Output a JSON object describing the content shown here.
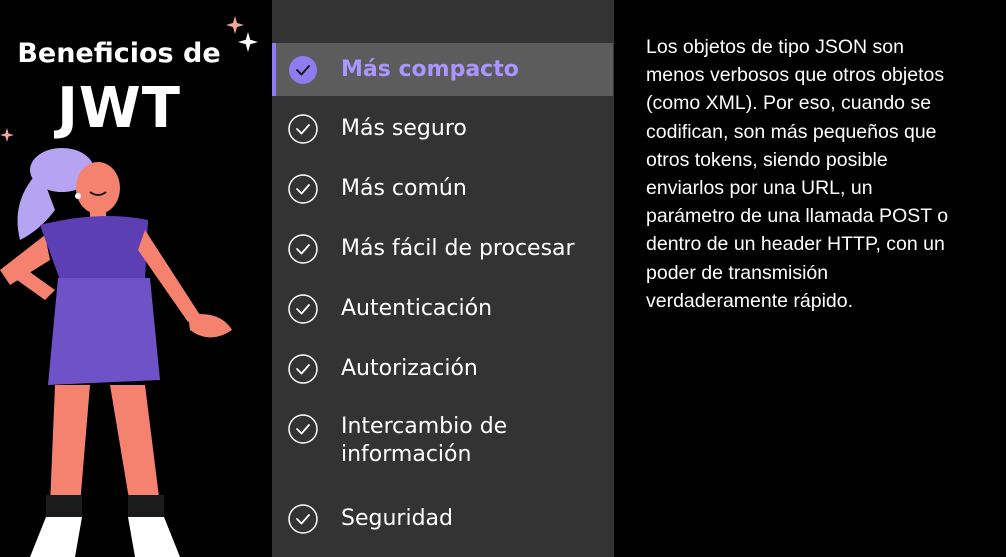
{
  "sidebar": {
    "title_line1": "Beneficios de",
    "title_line2": "JWT"
  },
  "menu": {
    "active_index": 0,
    "items": [
      {
        "label": "Más compacto"
      },
      {
        "label": "Más seguro"
      },
      {
        "label": "Más común"
      },
      {
        "label": "Más fácil de procesar"
      },
      {
        "label": "Autenticación"
      },
      {
        "label": "Autorización"
      },
      {
        "label": "Intercambio de información"
      },
      {
        "label": "Seguridad"
      }
    ]
  },
  "content": {
    "description": "Los objetos de tipo JSON son menos verbosos que otros objetos (como XML). Por eso, cuando se codifican, son más pequeños que otros tokens, siendo posible enviarlos por una URL, un parámetro de una llamada POST o dentro de un header HTTP, con un poder de transmisión verdaderamente rápido."
  },
  "colors": {
    "accent": "#8e7cf0",
    "active_text": "#a996ff",
    "menu_bg": "#333333",
    "active_bg": "#5c5c5c",
    "skin": "#f4826e",
    "dress": "#6a4fc4",
    "hair": "#b6a3f2"
  },
  "icons": {
    "check": "check-circle-icon",
    "sparkle": "sparkle-icon"
  }
}
